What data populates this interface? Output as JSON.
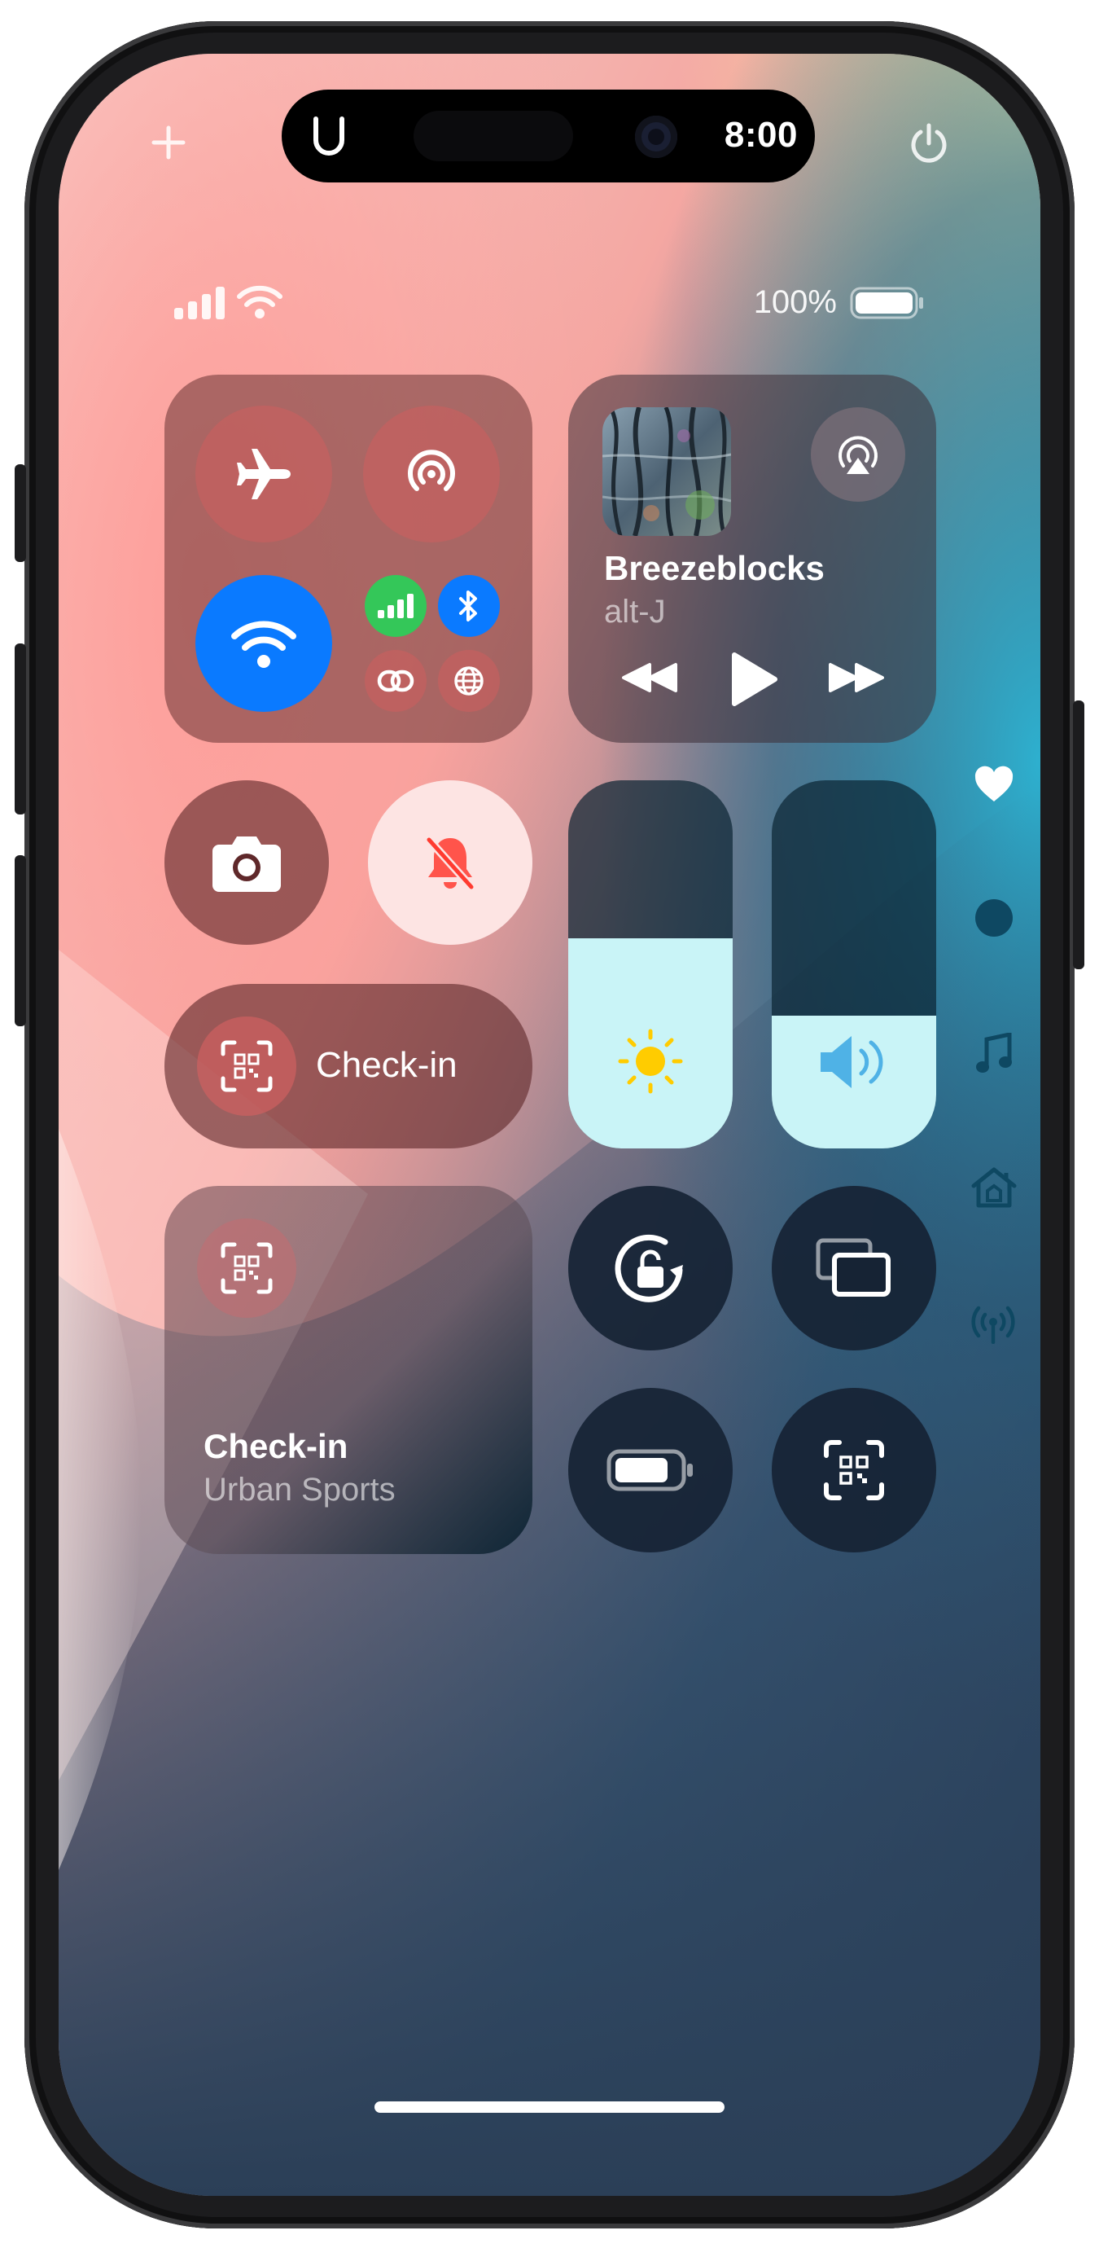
{
  "time": "8:00",
  "status": {
    "battery_percent": "100%"
  },
  "now_playing": {
    "title": "Breezeblocks",
    "artist": "alt-J"
  },
  "connectivity": {
    "wifi_on": true,
    "cellular_on": true,
    "bluetooth_on": true
  },
  "check_in_small": {
    "label": "Check-in"
  },
  "check_in_large": {
    "title": "Check-in",
    "subtitle": "Urban Sports"
  },
  "sliders": {
    "brightness_level": 0.57,
    "volume_level": 0.36
  },
  "page_indicator": [
    "heart-icon",
    "dot-icon",
    "music-note-icon",
    "home-icon",
    "antenna-icon"
  ],
  "colors": {
    "wifi_blue": "#0a7aff",
    "cellular_green": "#34c759",
    "bluetooth_blue": "#0a7aff",
    "sun_yellow": "#ffcc00",
    "volume_blue": "#4fb2e6",
    "slider_fill": "#c9f4f7"
  }
}
